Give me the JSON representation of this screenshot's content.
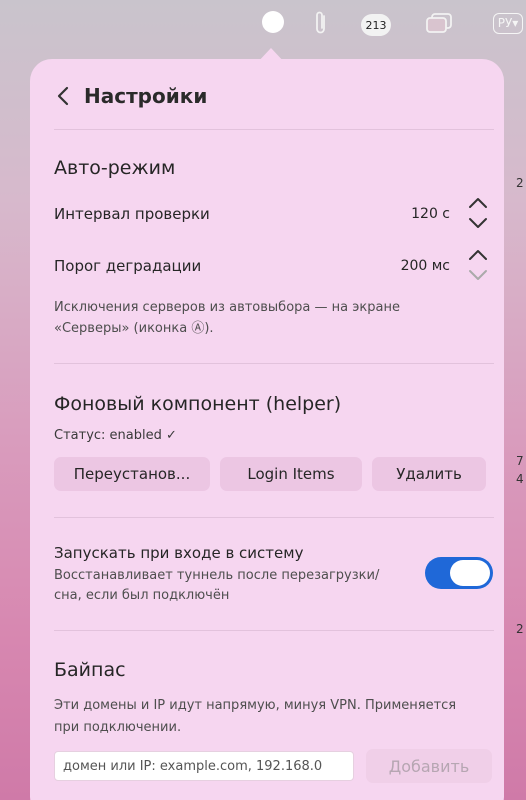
{
  "menubar": {
    "notification_badge": "213",
    "language": "РУ",
    "edge_numbers": [
      "2",
      "7",
      "4",
      "2"
    ]
  },
  "header": {
    "title": "Настройки"
  },
  "auto_mode": {
    "title": "Авто-режим",
    "check_interval_label": "Интервал проверки",
    "check_interval_value": "120 с",
    "degradation_label": "Порог деградации",
    "degradation_value": "200 мс",
    "note": "Исключения серверов из автовыбора — на экране «Серверы» (иконка Ⓐ)."
  },
  "helper": {
    "title": "Фоновый компонент (helper)",
    "status": "Статус: enabled ✓",
    "reinstall_label": "Переустанов...",
    "login_items_label": "Login Items",
    "delete_label": "Удалить"
  },
  "launch": {
    "label": "Запускать при входе в систему",
    "note": "Восстанавливает туннель после перезагрузки/сна, если был подключён",
    "enabled": true
  },
  "bypass": {
    "title": "Байпас",
    "note": "Эти домены и IP идут напрямую, минуя VPN. Применяется при подключении.",
    "input_placeholder": "домен или IP: example.com, 192.168.0",
    "add_label": "Добавить"
  },
  "colors": {
    "accent": "#1f68d8",
    "panel": "#f6d6f0",
    "button": "#ecc6e3"
  }
}
